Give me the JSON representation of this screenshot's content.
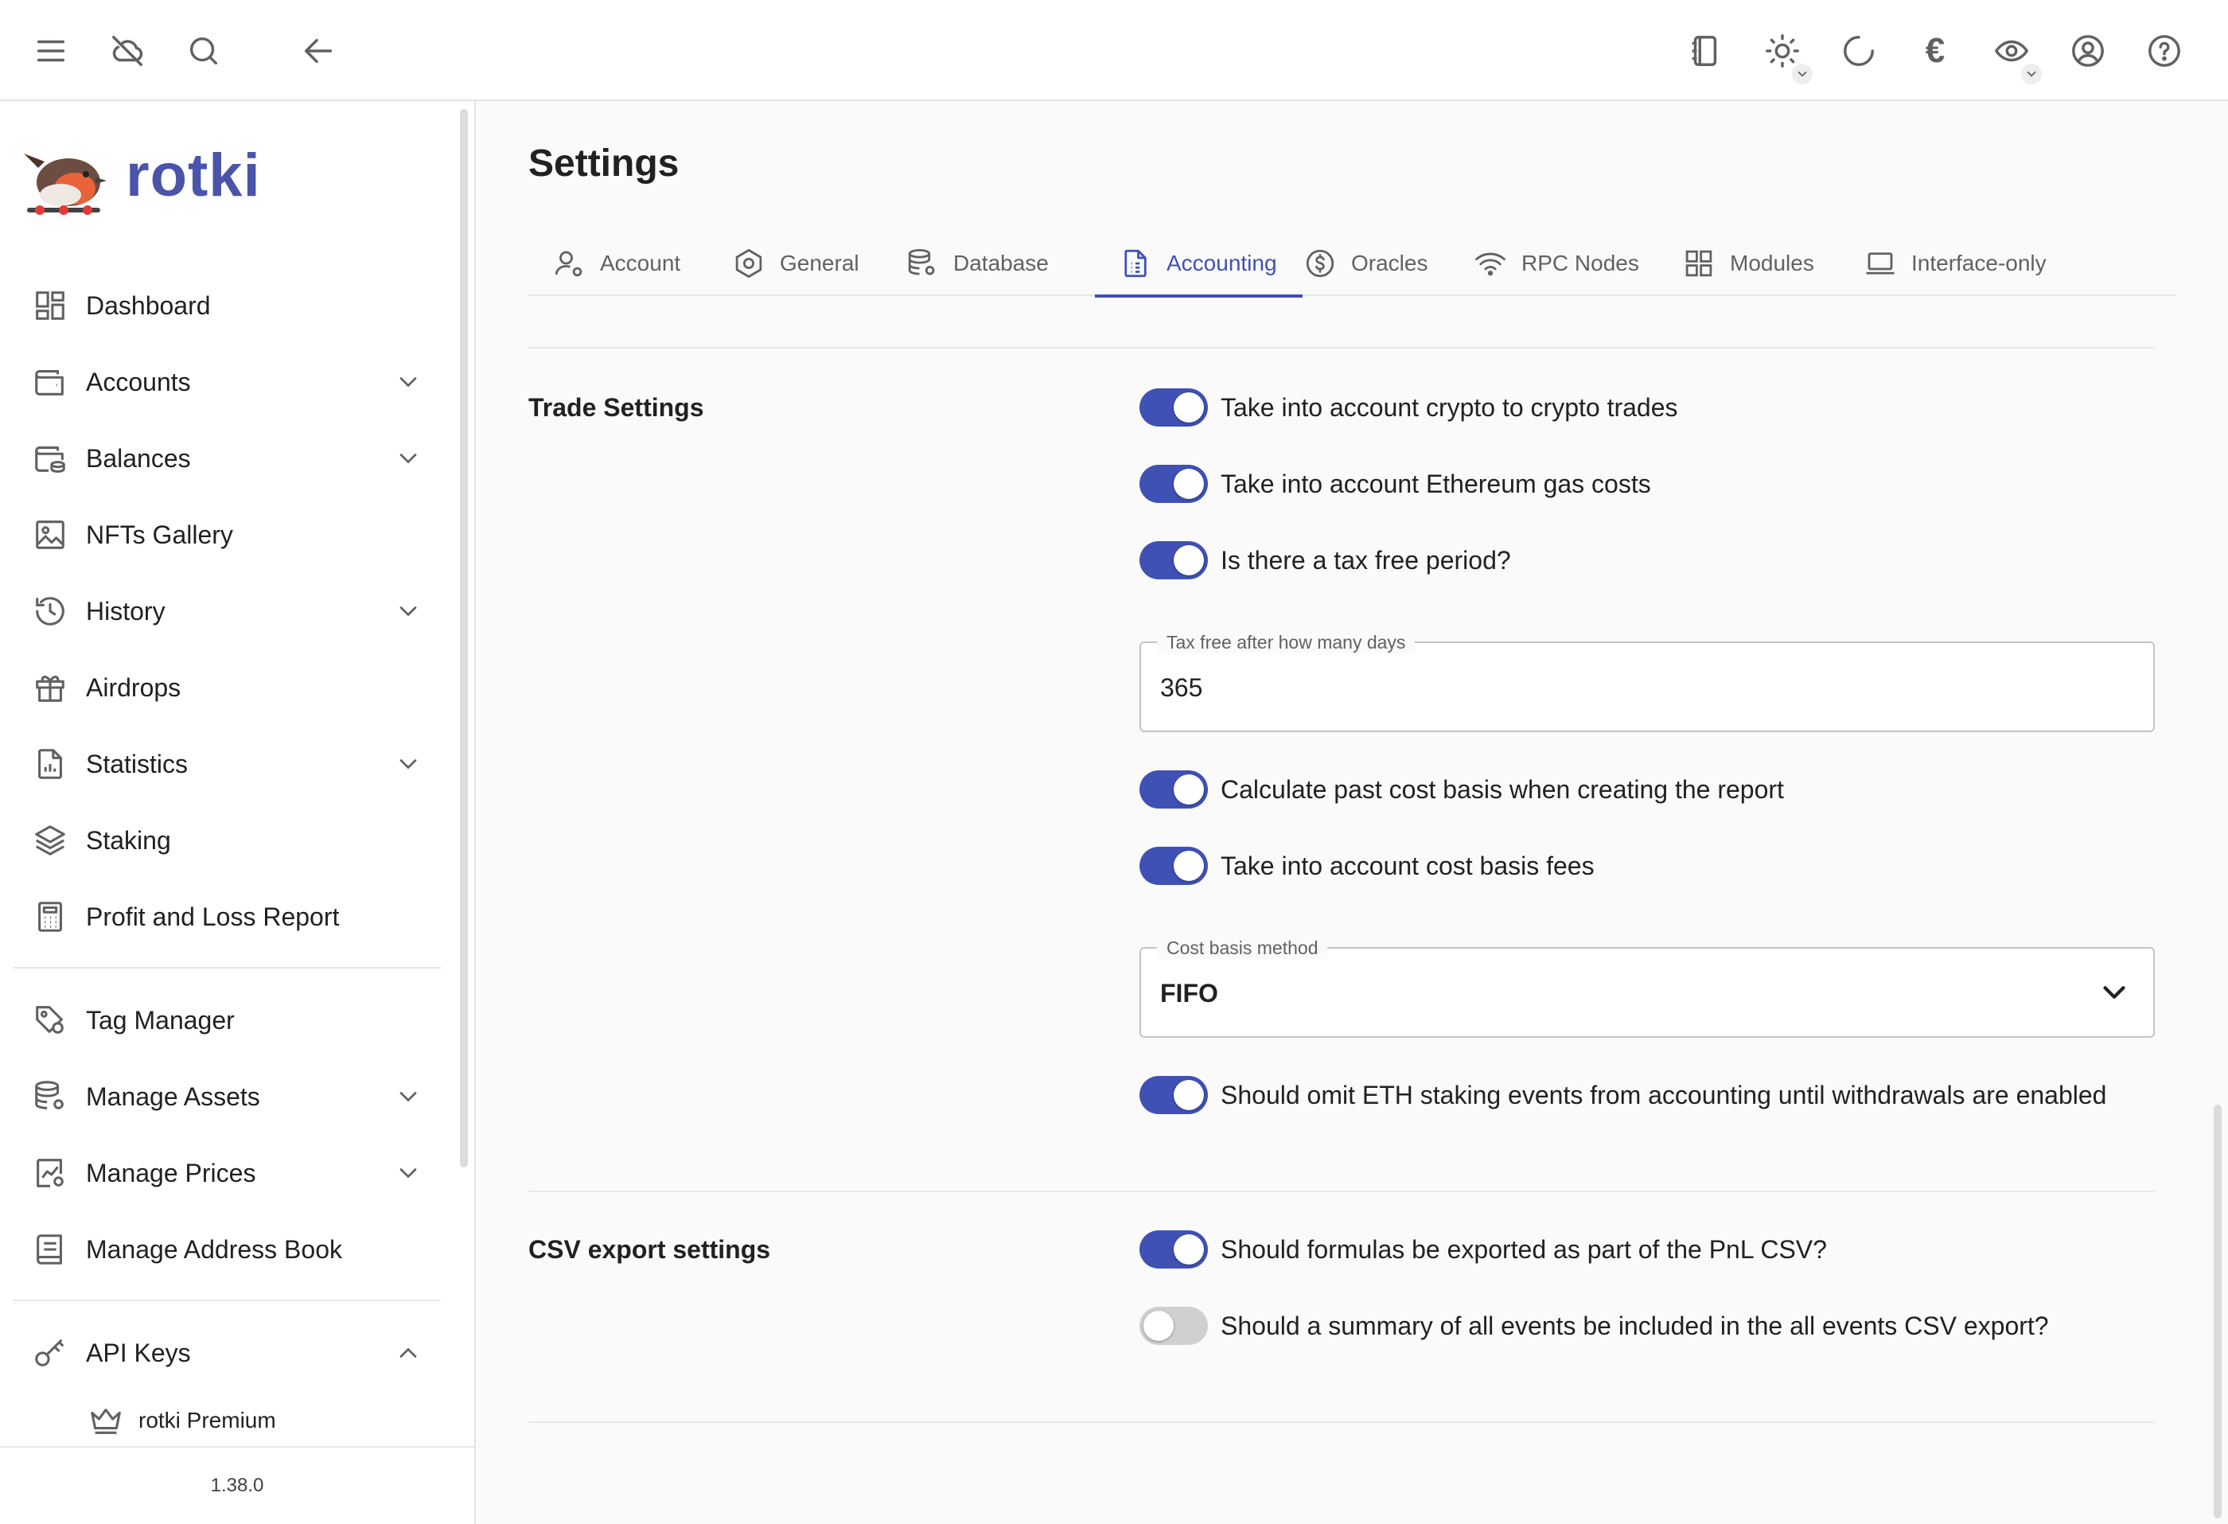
{
  "topbar": {
    "icons": [
      "menu-icon",
      "cloud-off-icon",
      "search-icon",
      "back-arrow-icon",
      "notes-icon",
      "theme-sun-icon",
      "refresh-icon",
      "currency-euro-icon",
      "visibility-eye-icon",
      "account-circle-icon",
      "help-icon"
    ],
    "currency_symbol": "€"
  },
  "sidebar": {
    "brand": "rotki",
    "items": [
      {
        "label": "Dashboard",
        "icon": "dashboard-icon",
        "expandable": false
      },
      {
        "label": "Accounts",
        "icon": "wallet-icon",
        "expandable": true
      },
      {
        "label": "Balances",
        "icon": "balances-icon",
        "expandable": true
      },
      {
        "label": "NFTs Gallery",
        "icon": "image-icon",
        "expandable": false
      },
      {
        "label": "History",
        "icon": "history-icon",
        "expandable": true
      },
      {
        "label": "Airdrops",
        "icon": "gift-icon",
        "expandable": false
      },
      {
        "label": "Statistics",
        "icon": "statistics-icon",
        "expandable": true
      },
      {
        "label": "Staking",
        "icon": "layers-icon",
        "expandable": false
      },
      {
        "label": "Profit and Loss Report",
        "icon": "calculator-icon",
        "expandable": false
      },
      {
        "label": "Tag Manager",
        "icon": "tag-icon",
        "expandable": false
      },
      {
        "label": "Manage Assets",
        "icon": "database-settings-icon",
        "expandable": true
      },
      {
        "label": "Manage Prices",
        "icon": "price-settings-icon",
        "expandable": true
      },
      {
        "label": "Manage Address Book",
        "icon": "address-book-icon",
        "expandable": false
      },
      {
        "label": "API Keys",
        "icon": "key-icon",
        "expandable": true
      }
    ],
    "sub_item": {
      "label": "rotki Premium",
      "icon": "crown-icon"
    },
    "version": "1.38.0"
  },
  "page": {
    "title": "Settings",
    "tabs": [
      {
        "label": "Account",
        "icon": "user-settings-icon"
      },
      {
        "label": "General",
        "icon": "hexagon-icon"
      },
      {
        "label": "Database",
        "icon": "database-icon"
      },
      {
        "label": "Accounting",
        "icon": "document-icon",
        "active": true
      },
      {
        "label": "Oracles",
        "icon": "dollar-circle-icon"
      },
      {
        "label": "RPC Nodes",
        "icon": "wifi-icon"
      },
      {
        "label": "Modules",
        "icon": "grid-icon"
      },
      {
        "label": "Interface-only",
        "icon": "laptop-icon"
      }
    ]
  },
  "trade_settings": {
    "title": "Trade Settings",
    "toggles": [
      {
        "label": "Take into account crypto to crypto trades",
        "on": true
      },
      {
        "label": "Take into account Ethereum gas costs",
        "on": true
      },
      {
        "label": "Is there a tax free period?",
        "on": true
      }
    ],
    "tax_free_field": {
      "label": "Tax free after how many days",
      "value": "365"
    },
    "toggles2": [
      {
        "label": "Calculate past cost basis when creating the report",
        "on": true
      },
      {
        "label": "Take into account cost basis fees",
        "on": true
      }
    ],
    "cost_basis": {
      "label": "Cost basis method",
      "value": "FIFO"
    },
    "eth_staking_toggle": {
      "label": "Should omit ETH staking events from accounting until withdrawals are enabled",
      "on": true
    }
  },
  "csv_settings": {
    "title": "CSV export settings",
    "toggles": [
      {
        "label": "Should formulas be exported as part of the PnL CSV?",
        "on": true
      },
      {
        "label": "Should a summary of all events be included in the all events CSV export?",
        "on": false
      }
    ]
  },
  "colors": {
    "accent": "#3f51b5",
    "brand": "#4a54a8",
    "switch_off": "#d0d0d0"
  }
}
